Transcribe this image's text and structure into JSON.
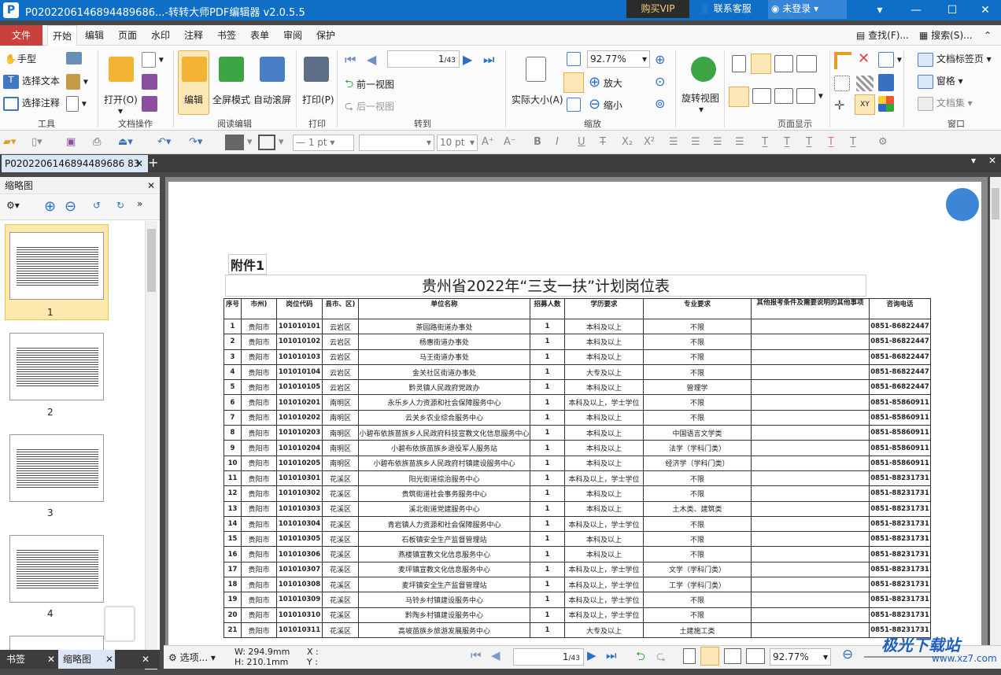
{
  "titlebar": {
    "title": "P0202206146894489686...-转转大师PDF编辑器 v2.0.5.5",
    "buy_vip": "购买VIP",
    "service": "联系客服",
    "login": "未登录"
  },
  "menu": {
    "file": "文件",
    "items": [
      "开始",
      "编辑",
      "页面",
      "水印",
      "注释",
      "书签",
      "表单",
      "审阅",
      "保护"
    ],
    "find": "查找(F)...",
    "search": "搜索(S)..."
  },
  "ribbon": {
    "tools": {
      "hand": "手型",
      "select_text": "选择文本",
      "select_annot": "选择注释",
      "group": "工具"
    },
    "docops": {
      "open": "打开(O)",
      "group": "文档操作"
    },
    "read": {
      "edit": "编辑",
      "fullscreen": "全屏模式",
      "autoscroll": "自动滚屏",
      "group": "阅读编辑"
    },
    "print": {
      "print": "打印(P)",
      "group": "打印"
    },
    "goto": {
      "page": "1",
      "total": "/43",
      "prev_view": "前一视图",
      "next_view": "后一视图",
      "group": "转到"
    },
    "zoom": {
      "actual": "实际大小(A)",
      "value": "92.77%",
      "zoom_in": "放大",
      "zoom_out": "缩小",
      "group": "缩放"
    },
    "rotate": {
      "label": "旋转视图"
    },
    "pagedisplay": {
      "group": "页面显示"
    },
    "window": {
      "bookmarks": "文档标签页",
      "window": "窗格",
      "collections": "文档集",
      "group": "窗口"
    }
  },
  "format": {
    "line": "1 pt",
    "font": "",
    "fontsize": "10 pt"
  },
  "doctab": {
    "name": "P0202206146894489686 83"
  },
  "left": {
    "title": "缩略图",
    "thumbs": [
      "1",
      "2",
      "3",
      "4"
    ],
    "tab_bookmark": "书签",
    "tab_thumbs": "缩略图"
  },
  "pdf": {
    "attach": "附件1",
    "title": "贵州省2022年“三支一扶”计划岗位表",
    "headers": [
      "序号",
      "市州)",
      "岗位代码",
      "县市、区)",
      "单位名称",
      "招募人数",
      "学历要求",
      "专业要求",
      "其他报考条件及需要说明的其他事项",
      "咨询电话"
    ],
    "rows": [
      [
        "1",
        "贵阳市",
        "101010101",
        "云岩区",
        "茶园路街道办事处",
        "1",
        "本科及以上",
        "不限",
        "",
        "0851-86822447"
      ],
      [
        "2",
        "贵阳市",
        "101010102",
        "云岩区",
        "杨惠街道办事处",
        "1",
        "本科及以上",
        "不限",
        "",
        "0851-86822447"
      ],
      [
        "3",
        "贵阳市",
        "101010103",
        "云岩区",
        "马王街道办事处",
        "1",
        "本科及以上",
        "不限",
        "",
        "0851-86822447"
      ],
      [
        "4",
        "贵阳市",
        "101010104",
        "云岩区",
        "金关社区街道办事处",
        "1",
        "大专及以上",
        "不限",
        "",
        "0851-86822447"
      ],
      [
        "5",
        "贵阳市",
        "101010105",
        "云岩区",
        "黔灵镇人民政府党政办",
        "1",
        "本科及以上",
        "管理学",
        "",
        "0851-86822447"
      ],
      [
        "6",
        "贵阳市",
        "101010201",
        "南明区",
        "永乐乡人力资源和社会保障服务中心",
        "1",
        "本科及以上，学士学位",
        "不限",
        "",
        "0851-85860911"
      ],
      [
        "7",
        "贵阳市",
        "101010202",
        "南明区",
        "云关乡农业综合服务中心",
        "1",
        "本科及以上",
        "不限",
        "",
        "0851-85860911"
      ],
      [
        "8",
        "贵阳市",
        "101010203",
        "南明区",
        "小碧布依族苗族乡人民政府科技宣教文化信息服务中心",
        "1",
        "本科及以上",
        "中国语言文学类",
        "",
        "0851-85860911"
      ],
      [
        "9",
        "贵阳市",
        "101010204",
        "南明区",
        "小碧布依族苗族乡退役军人服务站",
        "1",
        "本科及以上",
        "法学（学科门类）",
        "",
        "0851-85860911"
      ],
      [
        "10",
        "贵阳市",
        "101010205",
        "南明区",
        "小碧布依族苗族乡人民政府村镇建设服务中心",
        "1",
        "本科及以上",
        "经济学（学科门类）",
        "",
        "0851-85860911"
      ],
      [
        "11",
        "贵阳市",
        "101010301",
        "花溪区",
        "阳光街道综治服务中心",
        "1",
        "本科及以上，学士学位",
        "不限",
        "",
        "0851-88231731"
      ],
      [
        "12",
        "贵阳市",
        "101010302",
        "花溪区",
        "贵筑街道社会事务服务中心",
        "1",
        "本科及以上",
        "不限",
        "",
        "0851-88231731"
      ],
      [
        "13",
        "贵阳市",
        "101010303",
        "花溪区",
        "溪北街道党建服务中心",
        "1",
        "本科及以上",
        "土木类、建筑类",
        "",
        "0851-88231731"
      ],
      [
        "14",
        "贵阳市",
        "101010304",
        "花溪区",
        "青岩镇人力资源和社会保障服务中心",
        "1",
        "本科及以上，学士学位",
        "不限",
        "",
        "0851-88231731"
      ],
      [
        "15",
        "贵阳市",
        "101010305",
        "花溪区",
        "石板镇安全生产监督管理站",
        "1",
        "本科及以上",
        "不限",
        "",
        "0851-88231731"
      ],
      [
        "16",
        "贵阳市",
        "101010306",
        "花溪区",
        "燕楼镇宣教文化信息服务中心",
        "1",
        "本科及以上",
        "不限",
        "",
        "0851-88231731"
      ],
      [
        "17",
        "贵阳市",
        "101010307",
        "花溪区",
        "麦坪镇宣教文化信息服务中心",
        "1",
        "本科及以上，学士学位",
        "文学（学科门类）",
        "",
        "0851-88231731"
      ],
      [
        "18",
        "贵阳市",
        "101010308",
        "花溪区",
        "麦坪镇安全生产监督管理站",
        "1",
        "本科及以上，学士学位",
        "工学（学科门类）",
        "",
        "0851-88231731"
      ],
      [
        "19",
        "贵阳市",
        "101010309",
        "花溪区",
        "马铃乡村镇建设服务中心",
        "1",
        "本科及以上，学士学位",
        "不限",
        "",
        "0851-88231731"
      ],
      [
        "20",
        "贵阳市",
        "101010310",
        "花溪区",
        "黔陶乡村镇建设服务中心",
        "1",
        "本科及以上，学士学位",
        "不限",
        "",
        "0851-88231731"
      ],
      [
        "21",
        "贵阳市",
        "101010311",
        "花溪区",
        "高坡苗族乡旅游发展服务中心",
        "1",
        "大专及以上",
        "土建施工类",
        "",
        "0851-88231731"
      ]
    ]
  },
  "status": {
    "options": "选项...",
    "width": "W: 294.9mm",
    "height": "H: 210.1mm",
    "x": "X :",
    "y": "Y :",
    "page": "1",
    "total": "/43",
    "zoom": "92.77%"
  },
  "watermark": {
    "text": "极光下载站",
    "url": "www.xz7.com"
  }
}
